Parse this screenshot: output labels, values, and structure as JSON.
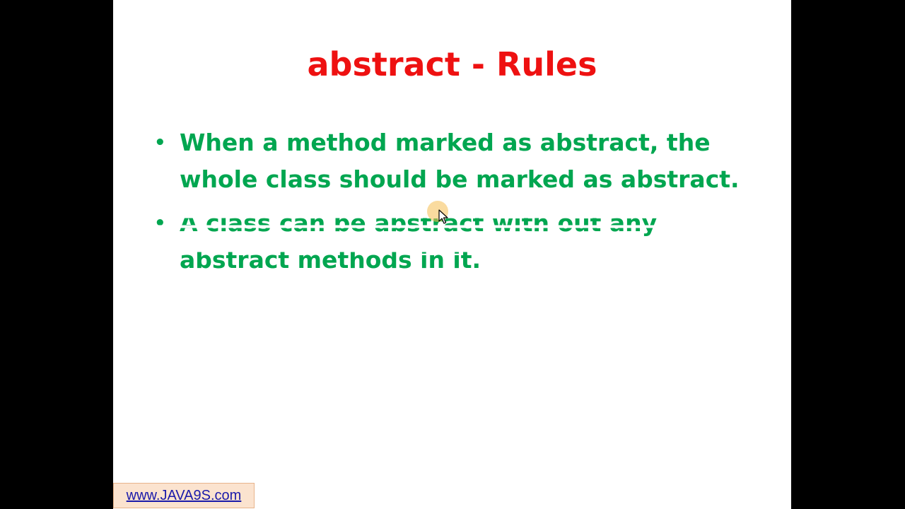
{
  "slide": {
    "title": "abstract - Rules",
    "bullets": [
      {
        "text": "When a method marked as abstract, the whole class should be marked as abstract."
      },
      {
        "text": "A class can be abstract with out any abstract methods in it."
      }
    ],
    "bullet_glyph": "•"
  },
  "footer": {
    "link_text": "www.JAVA9S.com"
  },
  "colors": {
    "title": "#ee1111",
    "bullet_text": "#00a650",
    "link": "#1a1aaa",
    "link_bg": "#fbe3cf",
    "cursor_highlight": "#f5be50"
  },
  "icons": {
    "cursor": "mouse-pointer-icon"
  }
}
